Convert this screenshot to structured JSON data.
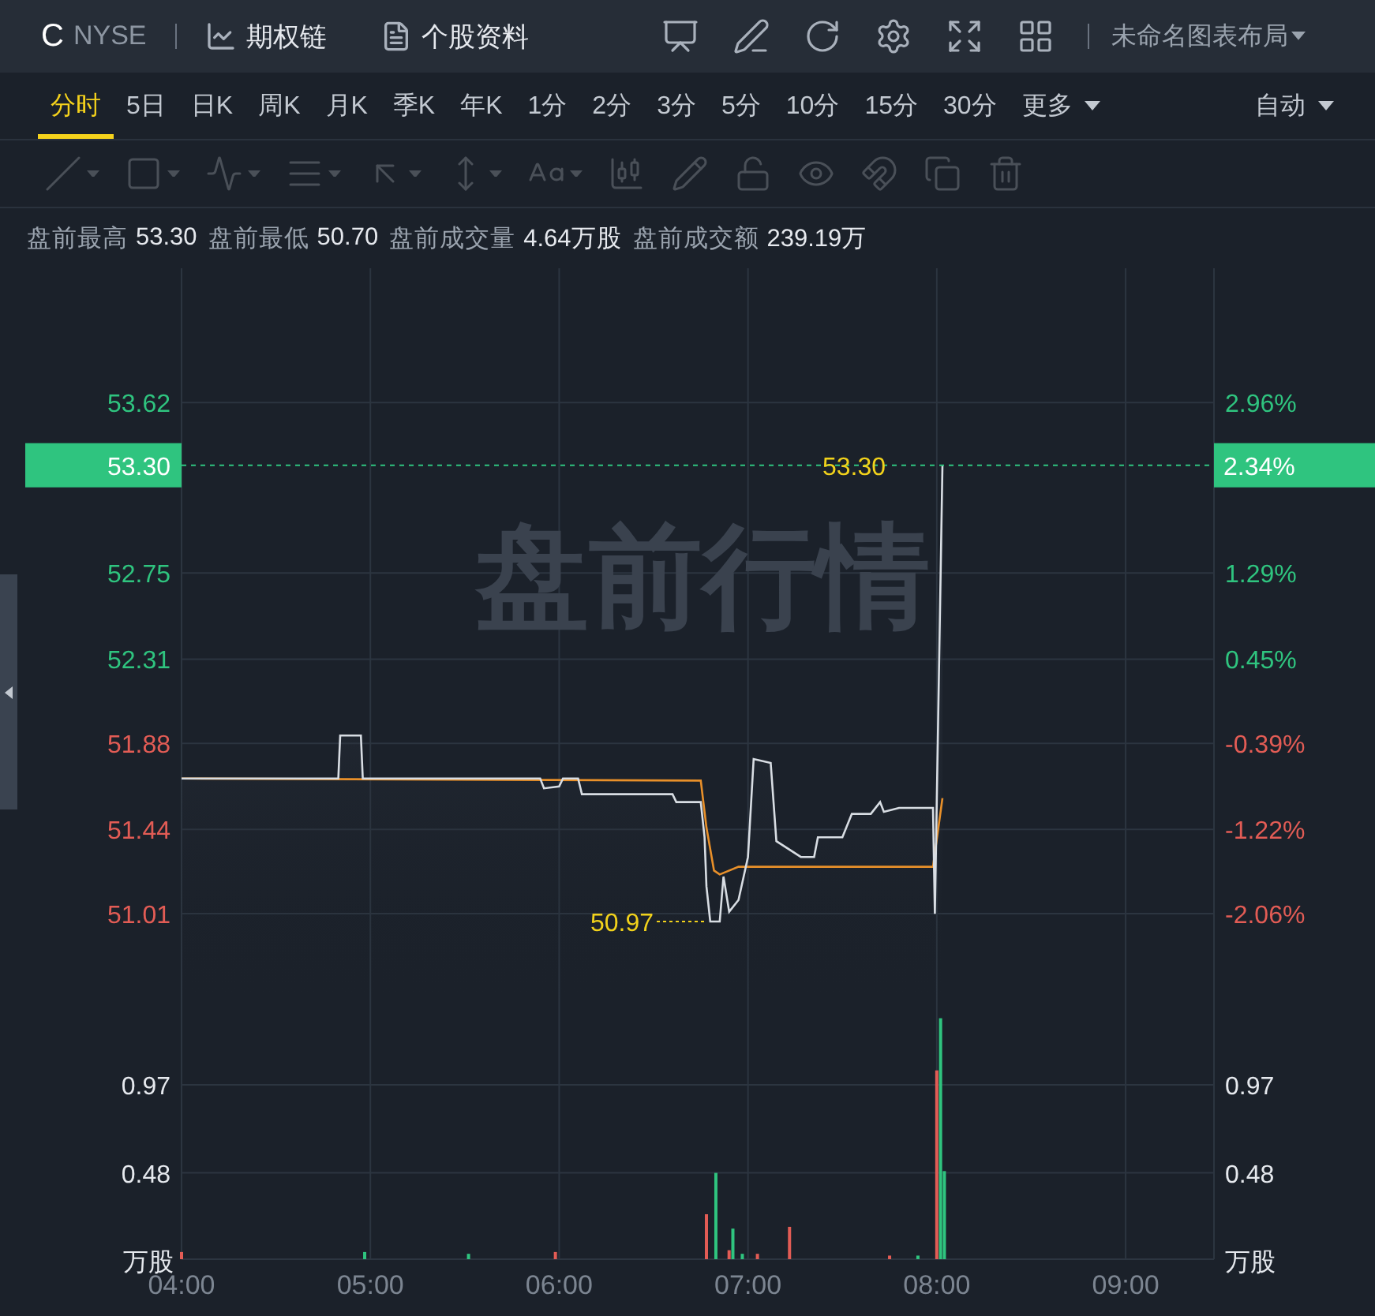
{
  "header": {
    "symbol": "C",
    "exchange": "NYSE",
    "links": [
      {
        "kind": "chart",
        "label": "期权链"
      },
      {
        "kind": "doc",
        "label": "个股资料"
      }
    ],
    "tools": [
      {
        "kind": "monitor"
      },
      {
        "kind": "pen"
      },
      {
        "kind": "refresh"
      },
      {
        "kind": "settings"
      },
      {
        "kind": "expand"
      },
      {
        "kind": "grid"
      }
    ],
    "layout_name": "未命名图表布局"
  },
  "periods": [
    {
      "label": "分时",
      "selected": true
    },
    {
      "label": "5日",
      "selected": false
    },
    {
      "label": "日K",
      "selected": false
    },
    {
      "label": "周K",
      "selected": false
    },
    {
      "label": "月K",
      "selected": false
    },
    {
      "label": "季K",
      "selected": false
    },
    {
      "label": "年K",
      "selected": false
    },
    {
      "label": "1分",
      "selected": false
    },
    {
      "label": "2分",
      "selected": false
    },
    {
      "label": "3分",
      "selected": false
    },
    {
      "label": "5分",
      "selected": false
    },
    {
      "label": "10分",
      "selected": false
    },
    {
      "label": "15分",
      "selected": false
    },
    {
      "label": "30分",
      "selected": false
    }
  ],
  "more": "更多",
  "scale_mode": "自动",
  "drawing_tools": [
    {
      "kind": "line",
      "menu": true,
      "disabled": true
    },
    {
      "kind": "rect",
      "menu": true,
      "disabled": true
    },
    {
      "kind": "wave",
      "menu": true,
      "disabled": true
    },
    {
      "kind": "fib",
      "menu": true,
      "disabled": true
    },
    {
      "kind": "arrow",
      "menu": true,
      "disabled": true
    },
    {
      "kind": "height",
      "menu": true,
      "disabled": true
    },
    {
      "kind": "text",
      "menu": true,
      "disabled": true
    },
    {
      "kind": "candles",
      "menu": false,
      "disabled": true
    },
    {
      "kind": "pencil",
      "menu": false,
      "disabled": true
    },
    {
      "kind": "lock",
      "menu": false,
      "disabled": true
    },
    {
      "kind": "eye",
      "menu": false,
      "disabled": true
    },
    {
      "kind": "magnet",
      "menu": false,
      "disabled": true
    },
    {
      "kind": "clone",
      "menu": false,
      "disabled": true
    },
    {
      "kind": "trash",
      "menu": false,
      "disabled": true
    }
  ],
  "stats": [
    {
      "label": "盘前最高",
      "value": "53.30"
    },
    {
      "label": "盘前最低",
      "value": "50.70"
    },
    {
      "label": "盘前成交量",
      "value": "4.64万股"
    },
    {
      "label": "盘前成交额",
      "value": "239.19万"
    }
  ],
  "price_chart": {
    "watermark": "盘前行情",
    "high_marker": "53.30",
    "low_marker": "50.97",
    "last_price_badge": {
      "change": "2.34%"
    },
    "right_axis": [
      {
        "label": "2.96%",
        "color": "#2fc47f"
      },
      {
        "label": "1.29%",
        "color": "#2fc47f"
      },
      {
        "label": "0.45%",
        "color": "#2fc47f"
      },
      {
        "label": "-0.39%",
        "color": "#e25c55"
      },
      {
        "label": "-1.22%",
        "color": "#e25c55"
      },
      {
        "label": "-2.06%",
        "color": "#e25c55"
      }
    ],
    "chart_data": {
      "type": "line",
      "grid": true,
      "xlim": [
        4,
        9.468
      ],
      "ylim": [
        50.535,
        54.306
      ],
      "ref_lines": [
        {
          "axis": "y",
          "value": 53.3,
          "label": "53.30",
          "color": "#2fc47f"
        }
      ],
      "yticks": [
        {
          "value": 53.62,
          "label": "53.62"
        },
        {
          "value": 52.75,
          "label": "52.75"
        },
        {
          "value": 52.31,
          "label": "52.31"
        },
        {
          "value": 51.88,
          "label": "51.88"
        },
        {
          "value": 51.44,
          "label": "51.44"
        },
        {
          "value": 51.01,
          "label": "51.01"
        }
      ],
      "series": [
        {
          "color": "#d8dde3",
          "x": [
            4,
            4.83,
            4.84,
            4.95,
            4.96,
            5.9,
            5.92,
            6.0,
            6.02,
            6.1,
            6.12,
            6.6,
            6.62,
            6.75,
            6.77,
            6.78,
            6.8,
            6.85,
            6.87,
            6.9,
            6.95,
            7.0,
            7.03,
            7.12,
            7.15,
            7.28,
            7.35,
            7.37,
            7.5,
            7.55,
            7.65,
            7.7,
            7.72,
            7.8,
            7.98,
            7.99,
            8.03
          ],
          "values": [
            51.7,
            51.7,
            51.92,
            51.92,
            51.7,
            51.7,
            51.65,
            51.66,
            51.7,
            51.7,
            51.62,
            51.62,
            51.58,
            51.58,
            51.4,
            51.15,
            50.97,
            50.97,
            51.2,
            51.02,
            51.08,
            51.3,
            51.8,
            51.78,
            51.38,
            51.3,
            51.3,
            51.4,
            51.4,
            51.52,
            51.52,
            51.58,
            51.53,
            51.55,
            51.55,
            51.01,
            53.3
          ]
        },
        {
          "color": "#e8902a",
          "x": [
            4,
            6.75,
            6.78,
            6.82,
            6.85,
            6.95,
            7.98,
            8.03
          ],
          "values": [
            51.7,
            51.69,
            51.45,
            51.23,
            51.21,
            51.25,
            51.25,
            51.6
          ]
        }
      ]
    }
  },
  "volume_chart": {
    "unit_left": "万股",
    "unit_right": "万股",
    "right_axis": [
      "0.97",
      "0.48"
    ],
    "chart_data": {
      "type": "bar",
      "grid": true,
      "xlim": [
        4,
        9.468
      ],
      "ylim": [
        0,
        1.404
      ],
      "yticks": [
        {
          "value": 0.97,
          "label": "0.97"
        },
        {
          "value": 0.48,
          "label": "0.48"
        }
      ],
      "xticks": [
        {
          "value": 4,
          "label": "04:00"
        },
        {
          "value": 5,
          "label": "05:00"
        },
        {
          "value": 6,
          "label": "06:00"
        },
        {
          "value": 7,
          "label": "07:00"
        },
        {
          "value": 8,
          "label": "08:00"
        },
        {
          "value": 9,
          "label": "09:00"
        }
      ],
      "series": [
        {
          "color": "#2fc47f",
          "x": [
            4.97,
            5.52,
            6.83,
            6.92,
            6.97,
            7.9,
            8.02,
            8.04
          ],
          "values": [
            0.04,
            0.03,
            0.48,
            0.17,
            0.03,
            0.02,
            1.34,
            0.49
          ]
        },
        {
          "color": "#e25c55",
          "x": [
            4,
            5.98,
            6.78,
            6.9,
            7.05,
            7.22,
            7.75,
            8.0
          ],
          "values": [
            0.04,
            0.04,
            0.25,
            0.05,
            0.03,
            0.18,
            0.02,
            1.05
          ]
        }
      ]
    }
  }
}
